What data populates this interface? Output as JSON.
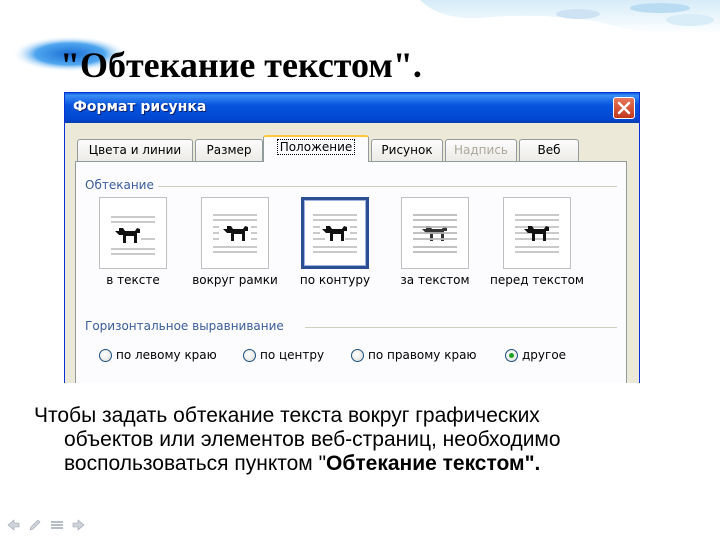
{
  "slide": {
    "title": "\"Обтекание текстом\".",
    "body_line1": "Чтобы задать обтекание текста вокруг графических",
    "body_line2": "объектов или элементов веб-страниц, необходимо",
    "body_line3_prefix": "воспользоваться пунктом \"",
    "body_line3_bold": "Обтекание текстом\".",
    "nav_icons": [
      "arrow-left-icon",
      "pencil-icon",
      "menu-icon",
      "arrow-right-icon"
    ]
  },
  "dialog": {
    "title": "Формат рисунка",
    "close_icon": "close-icon",
    "tabs": [
      {
        "label": "Цвета и линии",
        "state": "normal"
      },
      {
        "label": "Размер",
        "state": "normal"
      },
      {
        "label": "Положение",
        "state": "active"
      },
      {
        "label": "Рисунок",
        "state": "normal"
      },
      {
        "label": "Надпись",
        "state": "disabled"
      },
      {
        "label": "Веб",
        "state": "normal"
      }
    ],
    "wrapping": {
      "group_label": "Обтекание",
      "options": [
        {
          "label": "в тексте",
          "icon": "dog-inline-icon",
          "selected": false
        },
        {
          "label": "вокруг рамки",
          "icon": "dog-square-icon",
          "selected": false
        },
        {
          "label": "по контуру",
          "icon": "dog-tight-icon",
          "selected": true
        },
        {
          "label": "за текстом",
          "icon": "dog-behind-icon",
          "selected": false
        },
        {
          "label": "перед текстом",
          "icon": "dog-front-icon",
          "selected": false
        }
      ]
    },
    "alignment": {
      "group_label": "Горизонтальное выравнивание",
      "options": [
        {
          "label": "по левому краю",
          "checked": false
        },
        {
          "label": "по центру",
          "checked": false
        },
        {
          "label": "по правому краю",
          "checked": false
        },
        {
          "label": "другое",
          "checked": true
        }
      ]
    }
  },
  "colors": {
    "titlebar": "#0855dd",
    "selected_border": "#2c4f93",
    "group_label": "#3a5d9a",
    "active_tab_accent": "#ffc83c"
  }
}
